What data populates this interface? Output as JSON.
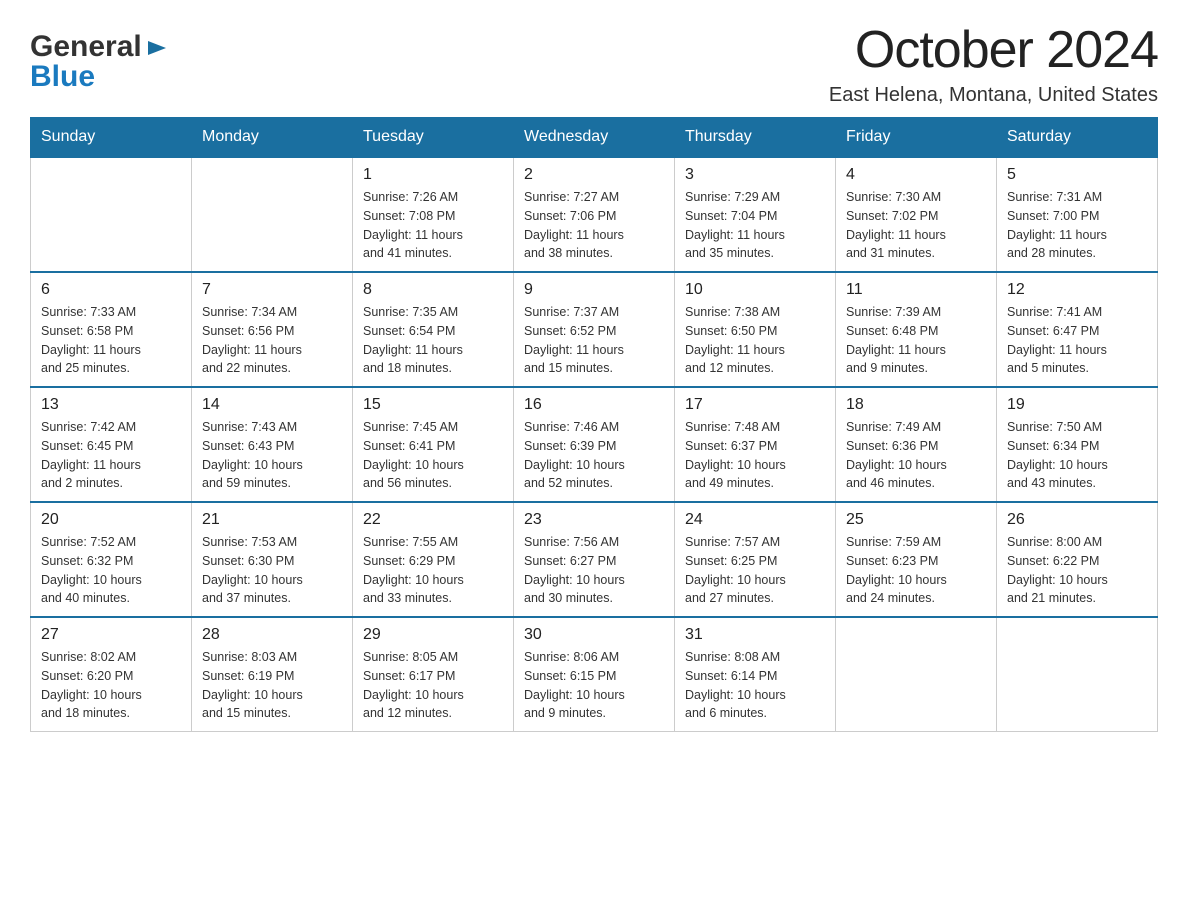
{
  "logo": {
    "line1": "General",
    "line2": "Blue"
  },
  "header": {
    "month": "October 2024",
    "location": "East Helena, Montana, United States"
  },
  "days_of_week": [
    "Sunday",
    "Monday",
    "Tuesday",
    "Wednesday",
    "Thursday",
    "Friday",
    "Saturday"
  ],
  "weeks": [
    [
      {
        "day": "",
        "info": ""
      },
      {
        "day": "",
        "info": ""
      },
      {
        "day": "1",
        "info": "Sunrise: 7:26 AM\nSunset: 7:08 PM\nDaylight: 11 hours\nand 41 minutes."
      },
      {
        "day": "2",
        "info": "Sunrise: 7:27 AM\nSunset: 7:06 PM\nDaylight: 11 hours\nand 38 minutes."
      },
      {
        "day": "3",
        "info": "Sunrise: 7:29 AM\nSunset: 7:04 PM\nDaylight: 11 hours\nand 35 minutes."
      },
      {
        "day": "4",
        "info": "Sunrise: 7:30 AM\nSunset: 7:02 PM\nDaylight: 11 hours\nand 31 minutes."
      },
      {
        "day": "5",
        "info": "Sunrise: 7:31 AM\nSunset: 7:00 PM\nDaylight: 11 hours\nand 28 minutes."
      }
    ],
    [
      {
        "day": "6",
        "info": "Sunrise: 7:33 AM\nSunset: 6:58 PM\nDaylight: 11 hours\nand 25 minutes."
      },
      {
        "day": "7",
        "info": "Sunrise: 7:34 AM\nSunset: 6:56 PM\nDaylight: 11 hours\nand 22 minutes."
      },
      {
        "day": "8",
        "info": "Sunrise: 7:35 AM\nSunset: 6:54 PM\nDaylight: 11 hours\nand 18 minutes."
      },
      {
        "day": "9",
        "info": "Sunrise: 7:37 AM\nSunset: 6:52 PM\nDaylight: 11 hours\nand 15 minutes."
      },
      {
        "day": "10",
        "info": "Sunrise: 7:38 AM\nSunset: 6:50 PM\nDaylight: 11 hours\nand 12 minutes."
      },
      {
        "day": "11",
        "info": "Sunrise: 7:39 AM\nSunset: 6:48 PM\nDaylight: 11 hours\nand 9 minutes."
      },
      {
        "day": "12",
        "info": "Sunrise: 7:41 AM\nSunset: 6:47 PM\nDaylight: 11 hours\nand 5 minutes."
      }
    ],
    [
      {
        "day": "13",
        "info": "Sunrise: 7:42 AM\nSunset: 6:45 PM\nDaylight: 11 hours\nand 2 minutes."
      },
      {
        "day": "14",
        "info": "Sunrise: 7:43 AM\nSunset: 6:43 PM\nDaylight: 10 hours\nand 59 minutes."
      },
      {
        "day": "15",
        "info": "Sunrise: 7:45 AM\nSunset: 6:41 PM\nDaylight: 10 hours\nand 56 minutes."
      },
      {
        "day": "16",
        "info": "Sunrise: 7:46 AM\nSunset: 6:39 PM\nDaylight: 10 hours\nand 52 minutes."
      },
      {
        "day": "17",
        "info": "Sunrise: 7:48 AM\nSunset: 6:37 PM\nDaylight: 10 hours\nand 49 minutes."
      },
      {
        "day": "18",
        "info": "Sunrise: 7:49 AM\nSunset: 6:36 PM\nDaylight: 10 hours\nand 46 minutes."
      },
      {
        "day": "19",
        "info": "Sunrise: 7:50 AM\nSunset: 6:34 PM\nDaylight: 10 hours\nand 43 minutes."
      }
    ],
    [
      {
        "day": "20",
        "info": "Sunrise: 7:52 AM\nSunset: 6:32 PM\nDaylight: 10 hours\nand 40 minutes."
      },
      {
        "day": "21",
        "info": "Sunrise: 7:53 AM\nSunset: 6:30 PM\nDaylight: 10 hours\nand 37 minutes."
      },
      {
        "day": "22",
        "info": "Sunrise: 7:55 AM\nSunset: 6:29 PM\nDaylight: 10 hours\nand 33 minutes."
      },
      {
        "day": "23",
        "info": "Sunrise: 7:56 AM\nSunset: 6:27 PM\nDaylight: 10 hours\nand 30 minutes."
      },
      {
        "day": "24",
        "info": "Sunrise: 7:57 AM\nSunset: 6:25 PM\nDaylight: 10 hours\nand 27 minutes."
      },
      {
        "day": "25",
        "info": "Sunrise: 7:59 AM\nSunset: 6:23 PM\nDaylight: 10 hours\nand 24 minutes."
      },
      {
        "day": "26",
        "info": "Sunrise: 8:00 AM\nSunset: 6:22 PM\nDaylight: 10 hours\nand 21 minutes."
      }
    ],
    [
      {
        "day": "27",
        "info": "Sunrise: 8:02 AM\nSunset: 6:20 PM\nDaylight: 10 hours\nand 18 minutes."
      },
      {
        "day": "28",
        "info": "Sunrise: 8:03 AM\nSunset: 6:19 PM\nDaylight: 10 hours\nand 15 minutes."
      },
      {
        "day": "29",
        "info": "Sunrise: 8:05 AM\nSunset: 6:17 PM\nDaylight: 10 hours\nand 12 minutes."
      },
      {
        "day": "30",
        "info": "Sunrise: 8:06 AM\nSunset: 6:15 PM\nDaylight: 10 hours\nand 9 minutes."
      },
      {
        "day": "31",
        "info": "Sunrise: 8:08 AM\nSunset: 6:14 PM\nDaylight: 10 hours\nand 6 minutes."
      },
      {
        "day": "",
        "info": ""
      },
      {
        "day": "",
        "info": ""
      }
    ]
  ]
}
